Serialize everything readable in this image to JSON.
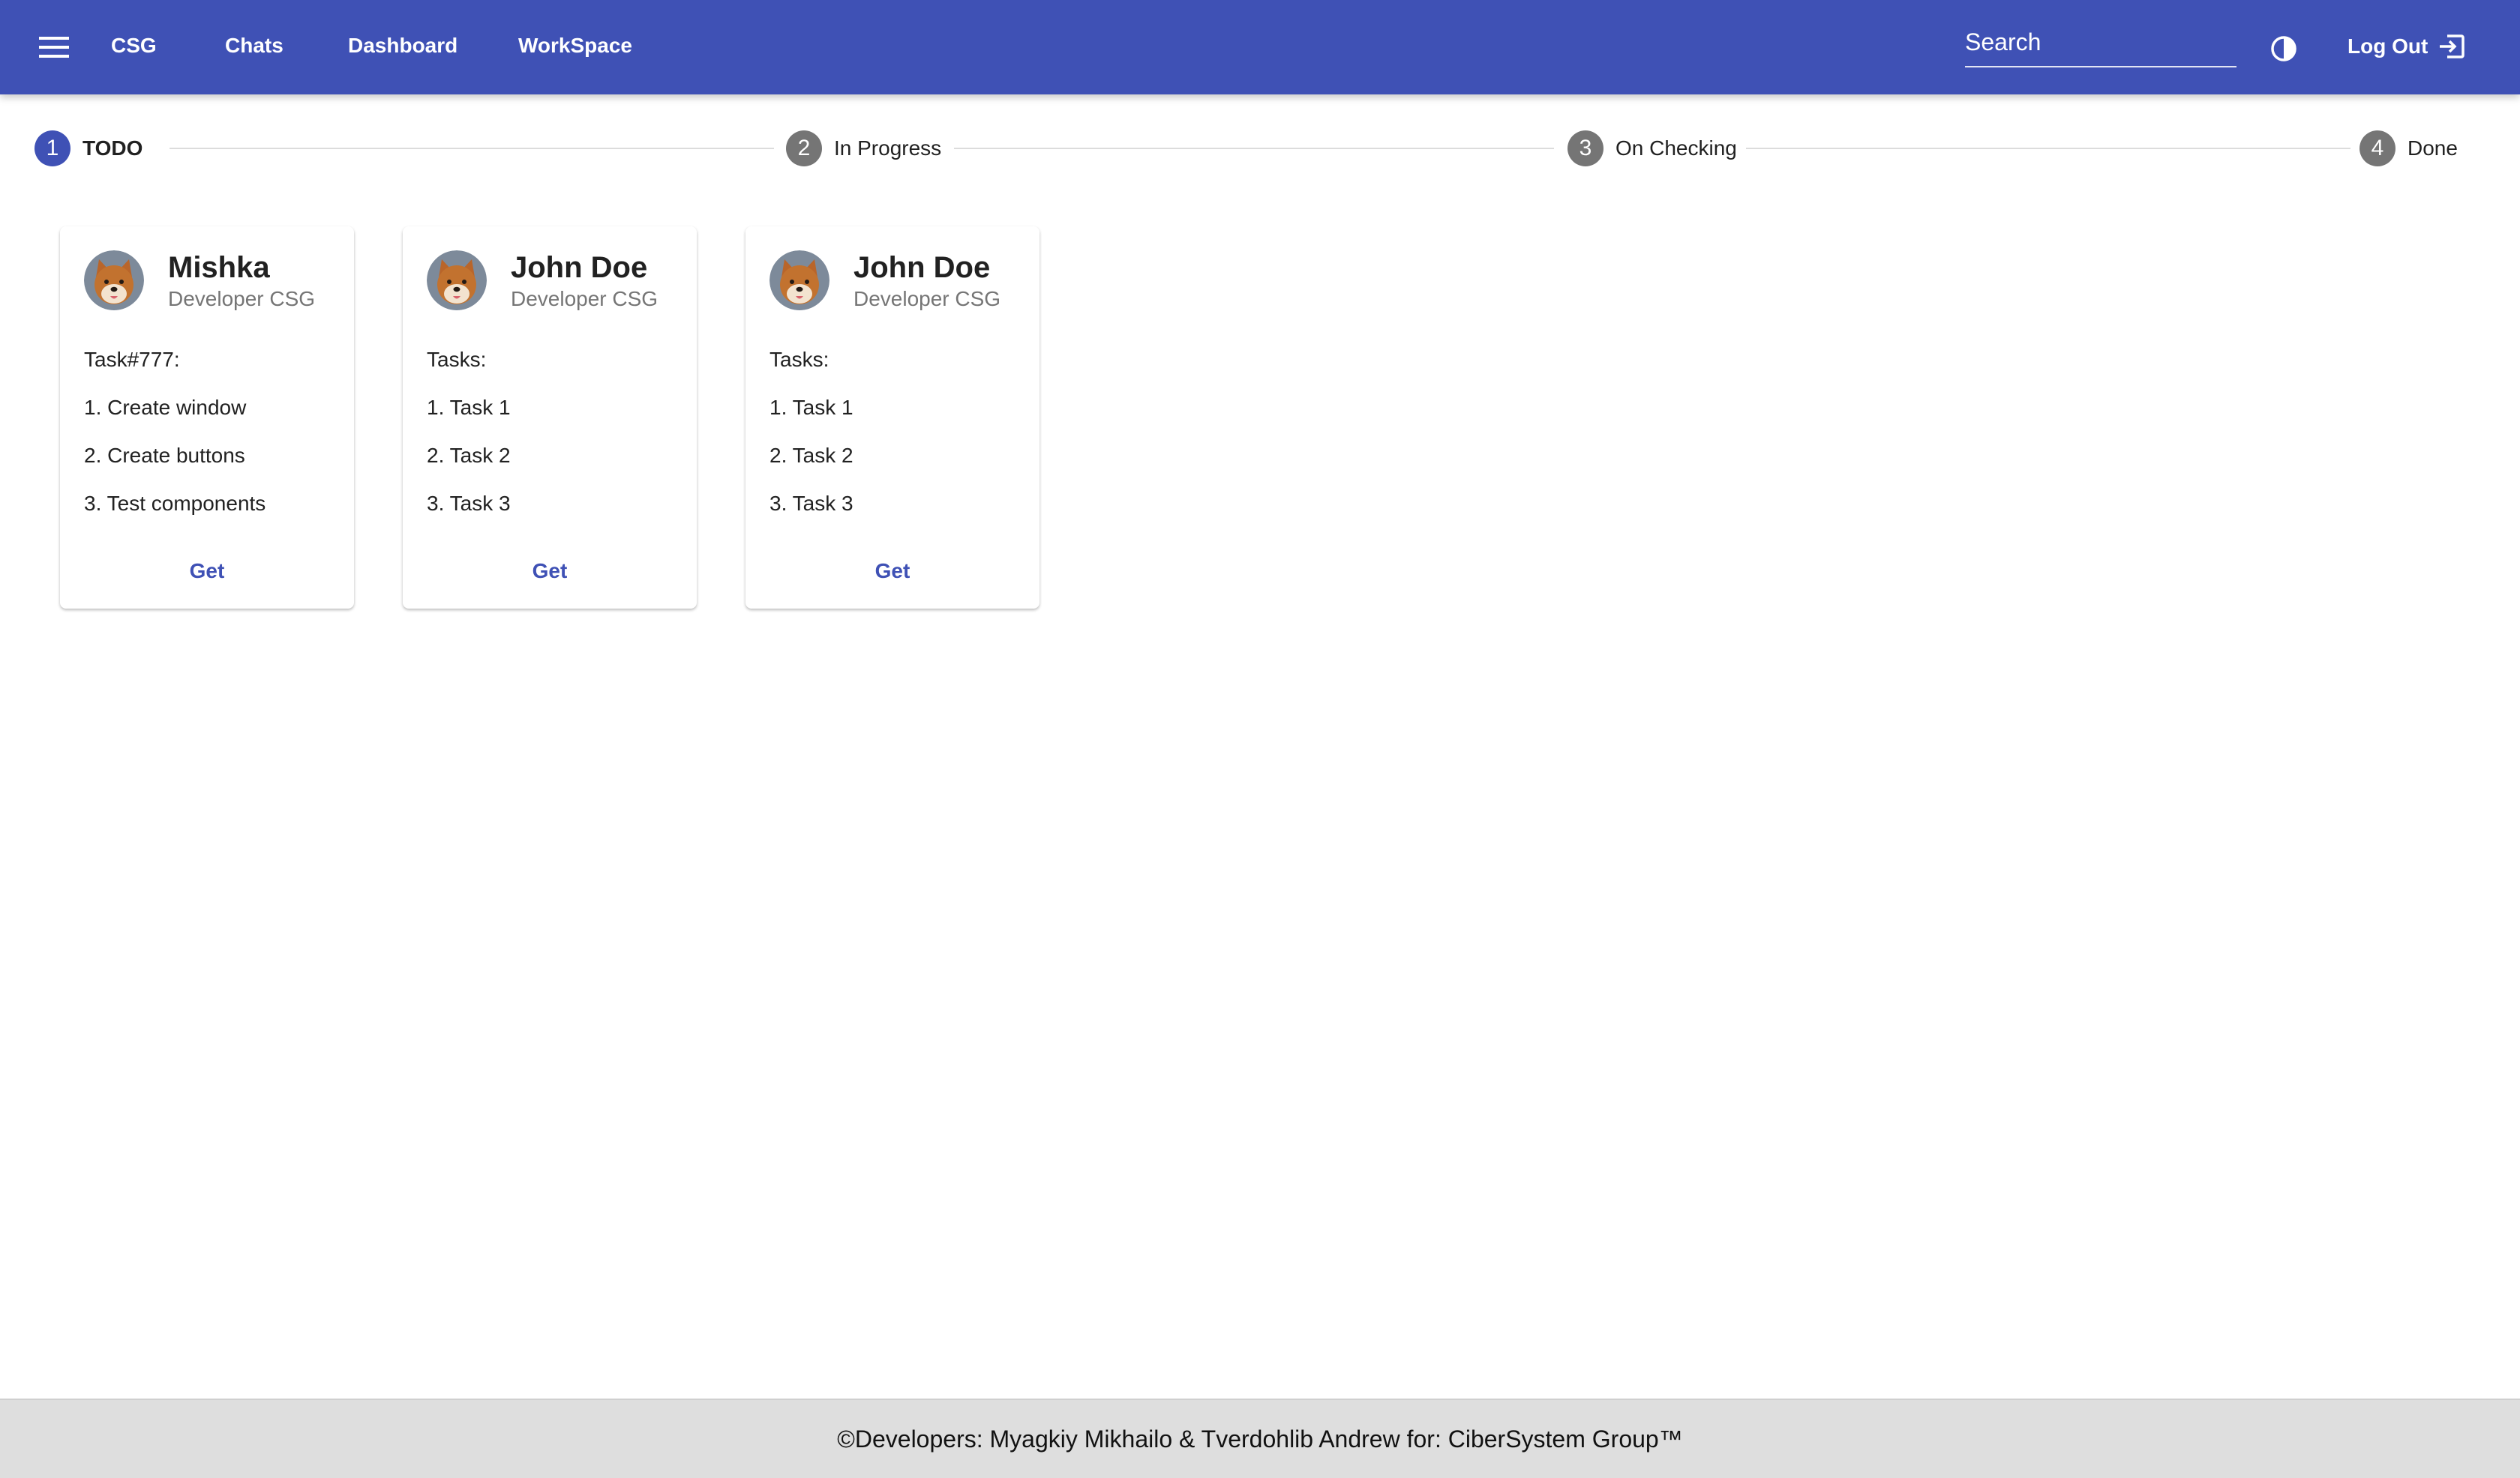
{
  "colors": {
    "primary": "#3f51b5",
    "step_inactive": "#757575",
    "footer_bg": "#dedede",
    "subtitle": "#757575"
  },
  "header": {
    "menu_icon": "menu-icon",
    "nav": [
      "CSG",
      "Chats",
      "Dashboard",
      "WorkSpace"
    ],
    "search": {
      "placeholder": "Search",
      "value": ""
    },
    "theme_icon": "contrast-icon",
    "logout_label": "Log Out",
    "logout_icon": "logout-icon"
  },
  "stepper": {
    "active_step": 1,
    "steps": [
      {
        "number": "1",
        "label": "TODO"
      },
      {
        "number": "2",
        "label": "In Progress"
      },
      {
        "number": "3",
        "label": "On Checking"
      },
      {
        "number": "4",
        "label": "Done"
      }
    ]
  },
  "cards": [
    {
      "avatar_icon": "dog-avatar",
      "name": "Mishka",
      "role": "Developer CSG",
      "lines": [
        "Task#777:",
        "1. Create window",
        "2. Create buttons",
        "3. Test components"
      ],
      "action": "Get"
    },
    {
      "avatar_icon": "dog-avatar",
      "name": "John Doe",
      "role": "Developer CSG",
      "lines": [
        "Tasks:",
        "1. Task 1",
        "2. Task 2",
        "3. Task 3"
      ],
      "action": "Get"
    },
    {
      "avatar_icon": "dog-avatar",
      "name": "John Doe",
      "role": "Developer CSG",
      "lines": [
        "Tasks:",
        "1. Task 1",
        "2. Task 2",
        "3. Task 3"
      ],
      "action": "Get"
    }
  ],
  "footer": {
    "text": "©Developers: Myagkiy Mikhailo & Tverdohlib Andrew for: CiberSystem Group™"
  }
}
